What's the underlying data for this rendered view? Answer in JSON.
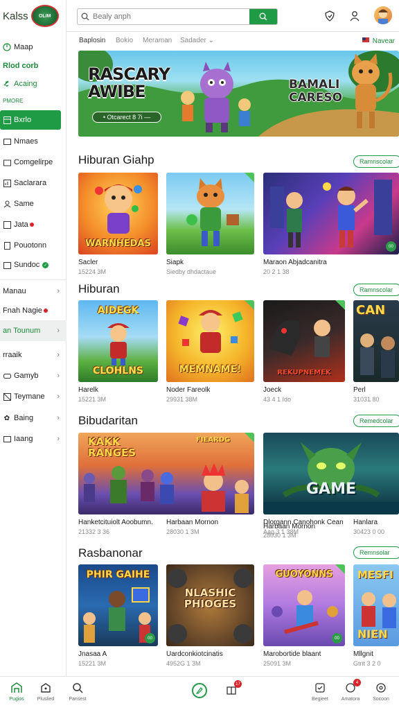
{
  "app": {
    "logo_text": "Kalss",
    "badge_text": "OLIM"
  },
  "sidebar": {
    "items": [
      {
        "label": "Maap",
        "icon": "power-icon"
      },
      {
        "label": "Rlod corb",
        "icon": ""
      },
      {
        "label": "Acaing",
        "icon": "link-icon"
      },
      {
        "label": "Bxrlo",
        "icon": ""
      },
      {
        "label": "Nmaes",
        "icon": ""
      },
      {
        "label": "Comgelirpe",
        "icon": ""
      },
      {
        "label": "Saclarara",
        "icon": ""
      },
      {
        "label": "Same",
        "icon": ""
      },
      {
        "label": "Jata",
        "icon": ""
      },
      {
        "label": "Pouotonn",
        "icon": ""
      },
      {
        "label": "Sundoc",
        "icon": ""
      }
    ],
    "section_label": "PMORE",
    "group_items": [
      {
        "label": "Manau"
      },
      {
        "label": "Fnah Nagie"
      },
      {
        "label": "an Tounum"
      },
      {
        "label": "rraaik"
      },
      {
        "label": "Gamyb"
      },
      {
        "label": "Teymane"
      },
      {
        "label": "Baing"
      },
      {
        "label": "Iaang"
      }
    ]
  },
  "topbar": {
    "search_placeholder": "Bealy anph"
  },
  "tabs": {
    "items": [
      "Baplosin",
      "Bokio",
      "Meraman",
      "Sadader"
    ],
    "right_label": "Navear"
  },
  "hero": {
    "title_line1": "RASCARY",
    "title_line2": "AWIBE",
    "pill": "• Otcarect 8 7i —",
    "right_line1": "BAMALI",
    "right_line2": "CARESO"
  },
  "sections": [
    {
      "title": "Hiburan Giahp",
      "button": "Ramnscolar",
      "cards": [
        {
          "title": "Sacler",
          "sub": "15224 3M",
          "art": "WARNHEDAS"
        },
        {
          "title": "Siapk",
          "sub": "Siedby dhdactaue",
          "art": ""
        },
        {
          "title": "Maraon Abjadcanitra",
          "sub": "20 2 1 38",
          "art": ""
        }
      ]
    },
    {
      "title": "Hiburan",
      "button": "Ramnscolar",
      "cards": [
        {
          "title": "Harelk",
          "sub": "15221 3M",
          "art_top": "AIDEGK",
          "art": "CLOHLNS"
        },
        {
          "title": "Noder Fareolk",
          "sub": "29931 38M",
          "art": "MEMNAME!"
        },
        {
          "title": "Joeck",
          "sub": "43 4 1 Ido",
          "art": "REKUPNEMEK"
        },
        {
          "title": "Perl",
          "sub": "31031 80",
          "art": "CAN"
        }
      ]
    },
    {
      "title": "Bibudaritan",
      "button": "Remedcolar",
      "cards": [
        {
          "title": "Hanketcituiolt Aoobumn.",
          "sub": "21332 3 36",
          "art": "KAKK RANGES",
          "art2": "FIEARDG"
        },
        {
          "title": "Harbaan Mornon",
          "sub": "28030 1 3M",
          "art": ""
        },
        {
          "title": "Dlorgann Canohonk Cean",
          "sub": "Aag 3 1 38M",
          "art": "GAME"
        },
        {
          "title": "Hanlara",
          "sub": "30423 0 00",
          "art": ""
        }
      ]
    },
    {
      "title": "Rasbanonar",
      "button": "Remnsolar",
      "cards": [
        {
          "title": "Jnasaa A",
          "sub": "15221 3M",
          "art": "PHIR GAIHE"
        },
        {
          "title": "Uardconkiotcinatis",
          "sub": "4952G 1 3M",
          "art": "NLASHIC PHIOGES"
        },
        {
          "title": "Marobortide blaant",
          "sub": "25091 3M",
          "art": "GUOYONNS"
        },
        {
          "title": "Mllgnit",
          "sub": "Gtrit 3 2 0",
          "art": "NIEN"
        }
      ]
    }
  ],
  "bottombar": {
    "items": [
      {
        "label": "Pugios"
      },
      {
        "label": "Pluslied"
      },
      {
        "label": "Pansest"
      },
      {
        "label": "Begieet"
      },
      {
        "label": "Amatora"
      },
      {
        "label": "Socoon"
      }
    ],
    "notif_count_1": "17",
    "notif_count_2": "4"
  },
  "colors": {
    "accent": "#1f9a45",
    "notification": "#d8232a"
  }
}
